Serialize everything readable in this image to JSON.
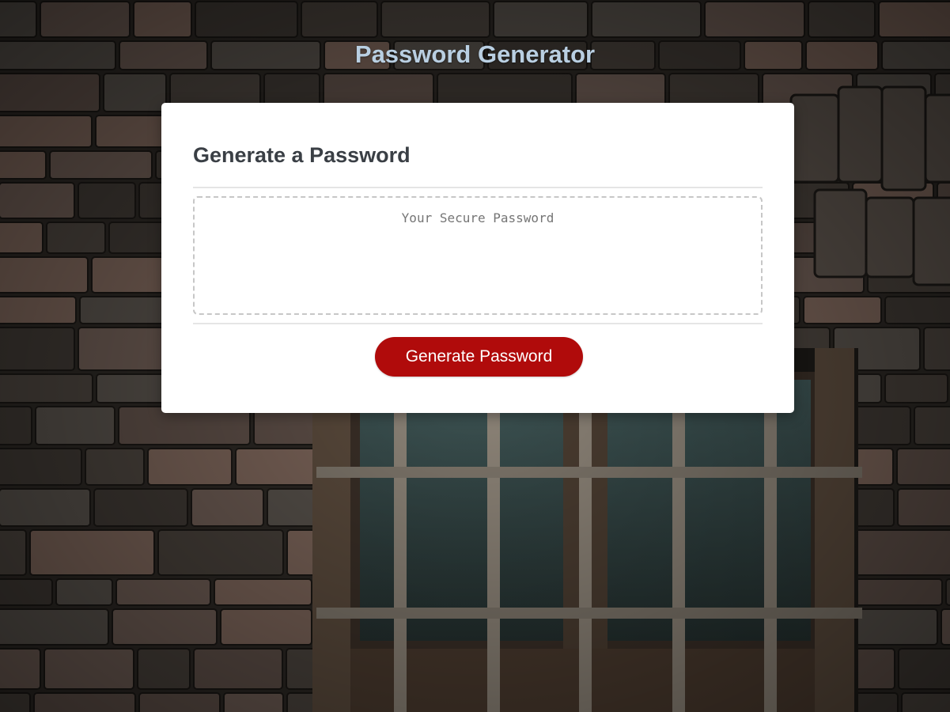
{
  "header": {
    "title": "Password Generator"
  },
  "card": {
    "title": "Generate a Password",
    "password_placeholder": "Your Secure Password",
    "password_value": "",
    "generate_label": "Generate Password"
  },
  "colors": {
    "title": "#b9cfe2",
    "button": "#b00b0b",
    "card_background": "#ffffff"
  },
  "background": {
    "icon": "stone-wall-barred-window-photo"
  }
}
